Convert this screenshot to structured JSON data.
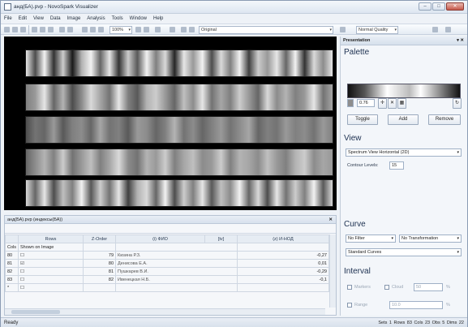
{
  "window": {
    "title": "анд(БА).pvp - NovoSpark Visualizer"
  },
  "menu": [
    "File",
    "Edit",
    "View",
    "Data",
    "Image",
    "Analysis",
    "Tools",
    "Window",
    "Help"
  ],
  "toolbar": {
    "zoom": "100%",
    "mode": "Original",
    "quality": "Normal Quality"
  },
  "strips": [
    {
      "name": "strip-1",
      "pattern": [
        0.9,
        0.3,
        0.95,
        0.2,
        0.8,
        0.1,
        0.7,
        0.95,
        0.4,
        0.9,
        0.2,
        0.8,
        0.35,
        0.95,
        0.5,
        0.85,
        0.15,
        0.9,
        0.6,
        0.95,
        0.3,
        0.85,
        0.5,
        0.95,
        0.25,
        0.8,
        0.6,
        0.9,
        0.4,
        0.95,
        0.2,
        0.85,
        0.55,
        0.9
      ]
    },
    {
      "name": "strip-2",
      "pattern": [
        0.5,
        0.6,
        0.9,
        0.4,
        0.7,
        0.3,
        0.55,
        0.85,
        0.65,
        0.45,
        0.9,
        0.5,
        0.35,
        0.7,
        0.8,
        0.6,
        0.4,
        0.75,
        0.55,
        0.9,
        0.45,
        0.65,
        0.5,
        0.8,
        0.6,
        0.4,
        0.85,
        0.55,
        0.7,
        0.5,
        0.6,
        0.9,
        0.45,
        0.65
      ]
    },
    {
      "name": "strip-3",
      "pattern": [
        0.3,
        0.45,
        0.4,
        0.6,
        0.35,
        0.5,
        0.55,
        0.4,
        0.65,
        0.45,
        0.5,
        0.35,
        0.6,
        0.55,
        0.4,
        0.5,
        0.7,
        0.45,
        0.55,
        0.4,
        0.5,
        0.6,
        0.45,
        0.55,
        0.65,
        0.4,
        0.5,
        0.45,
        0.6,
        0.5,
        0.55,
        0.45,
        0.6,
        0.5
      ]
    },
    {
      "name": "strip-4",
      "pattern": [
        0.4,
        0.55,
        0.7,
        0.5,
        0.8,
        0.45,
        0.6,
        0.75,
        0.5,
        0.65,
        0.85,
        0.55,
        0.45,
        0.7,
        0.6,
        0.8,
        0.5,
        0.65,
        0.75,
        0.55,
        0.6,
        0.8,
        0.5,
        0.7,
        0.65,
        0.55,
        0.75,
        0.6,
        0.5,
        0.7,
        0.8,
        0.55,
        0.65,
        0.6
      ]
    },
    {
      "name": "strip-5",
      "pattern": [
        0.85,
        0.4,
        0.9,
        0.3,
        0.75,
        0.5,
        0.95,
        0.35,
        0.8,
        0.45,
        0.9,
        0.25,
        0.7,
        0.85,
        0.4,
        0.95,
        0.3,
        0.8,
        0.5,
        0.9,
        0.35,
        0.75,
        0.55,
        0.95,
        0.4,
        0.85,
        0.3,
        0.9,
        0.45,
        0.8,
        0.5,
        0.95,
        0.35,
        0.85
      ]
    }
  ],
  "presentation": {
    "header": "Presentation",
    "palette_title": "Palette",
    "palette_value": "0.76",
    "toggle": "Toggle",
    "add": "Add",
    "remove": "Remove",
    "view_title": "View",
    "view_mode": "Spectrum View Horizontal (2D)",
    "contour_label": "Contour Levels:",
    "contour_value": "15",
    "curve_title": "Curve",
    "filter": "No Filter",
    "transformation": "No Transformation",
    "curves": "Standard Curves",
    "interval_title": "Interval",
    "markers": "Markers",
    "cloud": "Cloud",
    "cloud_value": "50",
    "range": "Range",
    "range_value": "10.0",
    "pct": "%"
  },
  "bottom": {
    "header": "анд(БА).pvp (индексы(БА))",
    "table": {
      "headers": [
        "",
        "Rows",
        "Z-Order",
        "(i) ФИО",
        "[tv]",
        "(z) И-НОД"
      ],
      "rows": [
        {
          "col": "Cols",
          "label": "Shown on Image",
          "num": "",
          "name": "",
          "value": ""
        },
        {
          "col": "80",
          "label": "",
          "num": "79",
          "name": "Кизина Р.З.",
          "value": "-0,27"
        },
        {
          "col": "81",
          "label": "",
          "num": "80",
          "name": "Денисова Е.А.",
          "value": "0,01"
        },
        {
          "col": "82",
          "label": "",
          "num": "81",
          "name": "Пушкарев В.И.",
          "value": "-0,29"
        },
        {
          "col": "83",
          "label": "",
          "num": "82",
          "name": "Ивенецкая Н.Б.",
          "value": "-0,1"
        },
        {
          "col": "*",
          "label": "",
          "num": "",
          "name": "",
          "value": ""
        }
      ]
    }
  },
  "status": {
    "ready": "Ready",
    "stats": "Sets 1  Rows 83  Cols 23  Obs 5  Dims 22"
  }
}
